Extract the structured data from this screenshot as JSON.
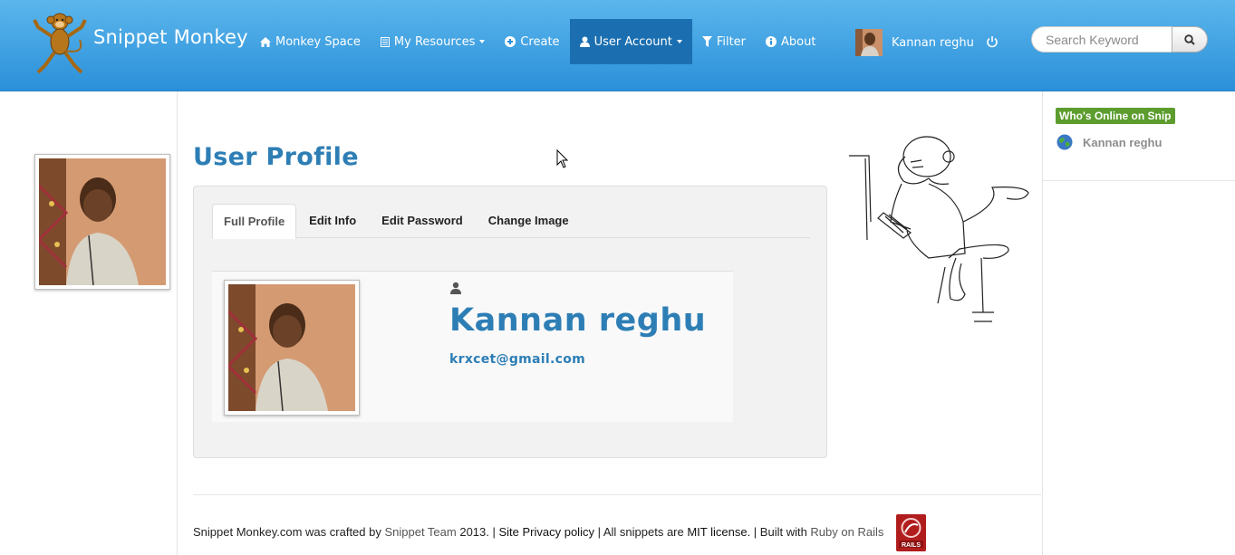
{
  "brand": {
    "name": "Snippet Monkey",
    "logo_icon": "monkey-logo-icon"
  },
  "nav": {
    "items": [
      {
        "label": "Monkey Space",
        "icon": "home-icon"
      },
      {
        "label": "My Resources",
        "icon": "list-icon",
        "dropdown": true
      },
      {
        "label": "Create",
        "icon": "plus-circle-icon"
      },
      {
        "label": "User Account",
        "icon": "user-icon",
        "dropdown": true,
        "active": true
      },
      {
        "label": "Filter",
        "icon": "filter-icon"
      },
      {
        "label": "About",
        "icon": "info-icon"
      }
    ],
    "user_name": "Kannan reghu",
    "power_icon": "power-icon"
  },
  "search": {
    "placeholder": "Search Keyword",
    "value": ""
  },
  "main": {
    "title": "User Profile",
    "tabs": [
      {
        "label": "Full Profile",
        "active": true
      },
      {
        "label": "Edit Info"
      },
      {
        "label": "Edit Password"
      },
      {
        "label": "Change Image"
      }
    ],
    "profile": {
      "name": "Kannan reghu",
      "email": "krxcet@gmail.com"
    }
  },
  "sidebar_right": {
    "badge": "Who's Online on Snip",
    "online_users": [
      "Kannan reghu"
    ]
  },
  "footer": {
    "part1": "Snippet Monkey.com was crafted by ",
    "team": "Snippet Team",
    "part2": " 2013. | ",
    "privacy": "Site Privacy policy",
    "part3": " | All snippets are ",
    "license": "MIT license.",
    "part4": " | Built with ",
    "rails": "Ruby on Rails"
  },
  "colors": {
    "navbar": "#2b90d9",
    "accent": "#2d7eb5",
    "online_badge": "#5c9d2e"
  }
}
